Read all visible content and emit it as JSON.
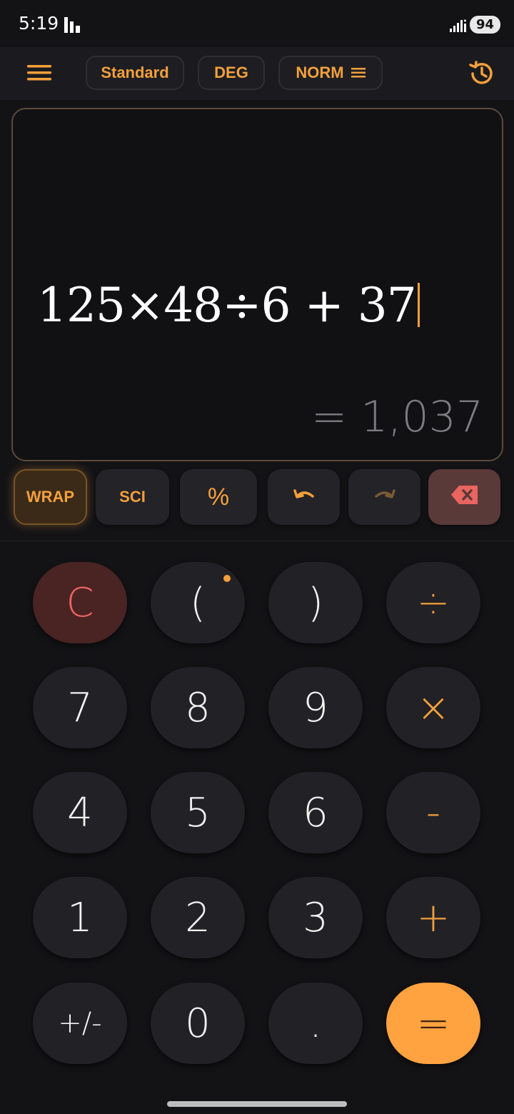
{
  "status_bar": {
    "time": "5:19",
    "battery": "94",
    "signal_icon": "signal-icon",
    "app_icon": "app-notification-icon"
  },
  "toolbar": {
    "menu_icon": "hamburger-menu-icon",
    "mode_label": "Standard",
    "angle_label": "DEG",
    "notation_label": "NORM",
    "history_icon": "history-icon",
    "accent_color": "#f4a03c"
  },
  "display": {
    "expression": "125×48÷6 + 37",
    "result": "= 1,037"
  },
  "function_row": {
    "wrap_label": "WRAP",
    "sci_label": "SCI",
    "percent_label": "%",
    "undo_icon": "undo-icon",
    "redo_icon": "redo-icon",
    "backspace_icon": "backspace-icon"
  },
  "keypad": {
    "clear": "C",
    "open_paren": "(",
    "close_paren": ")",
    "divide": "÷",
    "seven": "7",
    "eight": "8",
    "nine": "9",
    "multiply": "×",
    "four": "4",
    "five": "5",
    "six": "6",
    "minus": "-",
    "one": "1",
    "two": "2",
    "three": "3",
    "plus": "+",
    "sign": "+/-",
    "zero": "0",
    "decimal": ".",
    "equals": "="
  },
  "colors": {
    "accent": "#f4a03c",
    "equals_bg": "#ffa23f",
    "clear_text": "#e96560",
    "background": "#131316"
  }
}
